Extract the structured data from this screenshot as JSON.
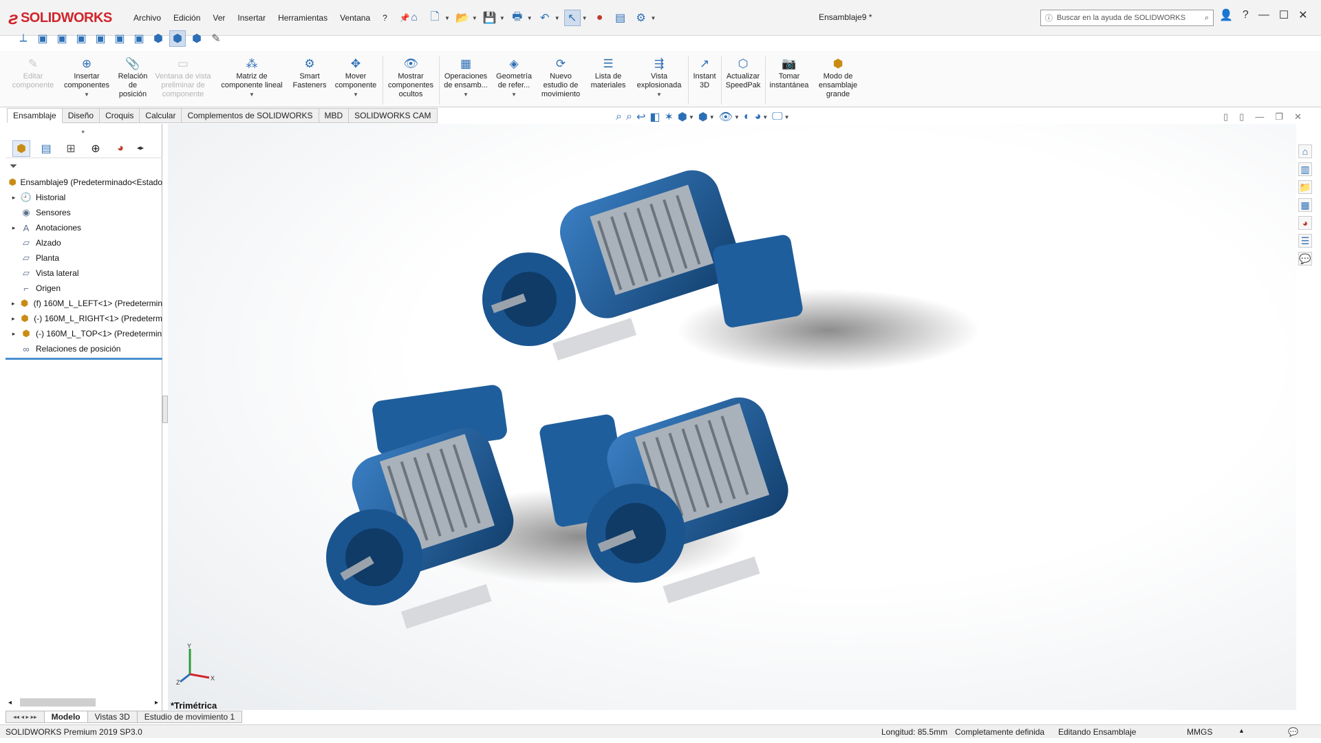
{
  "app": {
    "brand": "SOLIDWORKS",
    "document_title": "Ensamblaje9 *",
    "menu": [
      "Archivo",
      "Edición",
      "Ver",
      "Insertar",
      "Herramientas",
      "Ventana",
      "?"
    ],
    "help_search_placeholder": "Buscar en la ayuda de SOLIDWORKS"
  },
  "command_manager": {
    "commands": [
      {
        "label": "Editar componente",
        "icon": "edit-component-icon",
        "disabled": true
      },
      {
        "label": "Insertar componentes",
        "icon": "insert-components-icon",
        "disabled": false
      },
      {
        "label": "Relación de posición",
        "icon": "mate-icon",
        "disabled": false
      },
      {
        "label": "Ventana de vista preliminar de componente",
        "icon": "preview-window-icon",
        "disabled": true
      },
      {
        "label": "Matriz de componente lineal",
        "icon": "linear-pattern-icon",
        "disabled": false
      },
      {
        "label": "Smart Fasteners",
        "icon": "smart-fasteners-icon",
        "disabled": false
      },
      {
        "label": "Mover componente",
        "icon": "move-component-icon",
        "disabled": false
      },
      {
        "label": "Mostrar componentes ocultos",
        "icon": "show-hidden-icon",
        "disabled": false
      },
      {
        "label": "Operaciones de ensamb...",
        "icon": "assembly-features-icon",
        "disabled": false
      },
      {
        "label": "Geometría de refer...",
        "icon": "reference-geometry-icon",
        "disabled": false
      },
      {
        "label": "Nuevo estudio de movimiento",
        "icon": "motion-study-icon",
        "disabled": false
      },
      {
        "label": "Lista de materiales",
        "icon": "bom-icon",
        "disabled": false
      },
      {
        "label": "Vista explosionada",
        "icon": "exploded-view-icon",
        "disabled": false
      },
      {
        "label": "Instant 3D",
        "icon": "instant3d-icon",
        "disabled": false
      },
      {
        "label": "Actualizar SpeedPak",
        "icon": "speedpak-icon",
        "disabled": false
      },
      {
        "label": "Tomar instantánea",
        "icon": "snapshot-icon",
        "disabled": false
      },
      {
        "label": "Modo de ensamblaje grande",
        "icon": "large-assembly-icon",
        "disabled": false
      }
    ],
    "tabs": [
      "Ensamblaje",
      "Diseño",
      "Croquis",
      "Calcular",
      "Complementos de SOLIDWORKS",
      "MBD",
      "SOLIDWORKS CAM"
    ],
    "active_tab": "Ensamblaje"
  },
  "feature_tree": {
    "items": [
      {
        "label": "Ensamblaje9  (Predeterminado<Estado",
        "icon": "assembly-icon",
        "expandable": false,
        "root": true
      },
      {
        "label": "Historial",
        "icon": "history-icon",
        "expandable": true
      },
      {
        "label": "Sensores",
        "icon": "sensors-icon",
        "expandable": false
      },
      {
        "label": "Anotaciones",
        "icon": "annotations-icon",
        "expandable": true
      },
      {
        "label": "Alzado",
        "icon": "plane-icon",
        "expandable": false
      },
      {
        "label": "Planta",
        "icon": "plane-icon",
        "expandable": false
      },
      {
        "label": "Vista lateral",
        "icon": "plane-icon",
        "expandable": false
      },
      {
        "label": "Origen",
        "icon": "origin-icon",
        "expandable": false
      },
      {
        "label": "(f) 160M_L_LEFT<1> (Predetermin",
        "icon": "subassembly-icon",
        "expandable": true
      },
      {
        "label": "(-) 160M_L_RIGHT<1> (Predeterm",
        "icon": "subassembly-icon",
        "expandable": true
      },
      {
        "label": "(-) 160M_L_TOP<1> (Predetermin",
        "icon": "subassembly-icon",
        "expandable": true
      },
      {
        "label": "Relaciones de posición",
        "icon": "mates-folder-icon",
        "expandable": false
      }
    ]
  },
  "viewport": {
    "orientation_label": "*Trimétrica",
    "triad": {
      "x": "X",
      "y": "Y",
      "z": "Z"
    },
    "model_color": "#1f5e9c"
  },
  "bottom_tabs": [
    "Modelo",
    "Vistas 3D",
    "Estudio de movimiento 1"
  ],
  "active_bottom_tab": "Modelo",
  "status": {
    "product": "SOLIDWORKS Premium 2019 SP3.0",
    "length": "Longitud: 85.5mm",
    "definition": "Completamente definida",
    "mode": "Editando Ensamblaje",
    "units": "MMGS"
  }
}
